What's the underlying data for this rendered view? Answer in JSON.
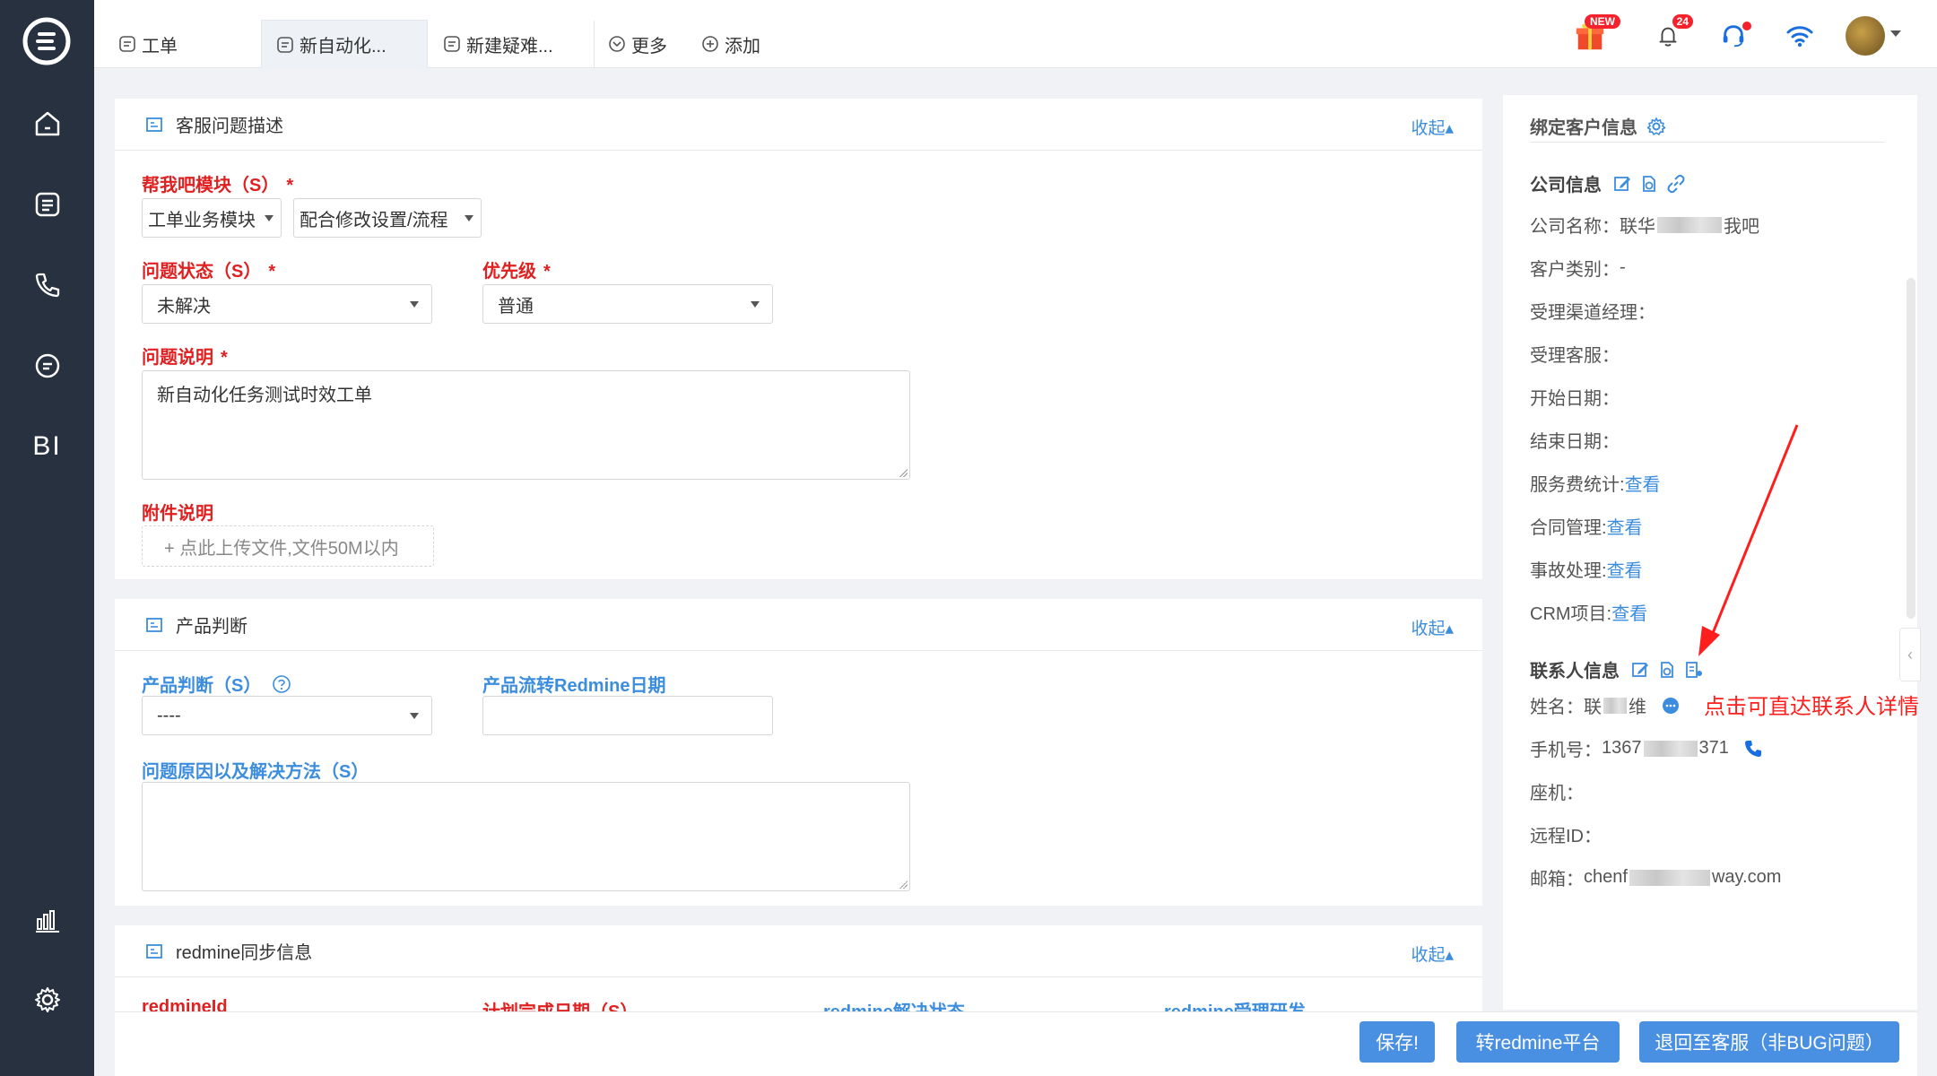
{
  "sidebar": {
    "logo_icon": "app-logo-icon",
    "items": [
      {
        "name": "home",
        "icon": "home-icon"
      },
      {
        "name": "ticket",
        "icon": "list-icon"
      },
      {
        "name": "phone",
        "icon": "phone-icon"
      },
      {
        "name": "chat",
        "icon": "chat-icon"
      },
      {
        "name": "bi",
        "label": "BI"
      },
      {
        "name": "stats",
        "icon": "bar-chart-icon"
      },
      {
        "name": "settings",
        "icon": "gear-icon"
      }
    ]
  },
  "tabs": [
    {
      "label": "工单",
      "active": false
    },
    {
      "label": "新自动化...",
      "active": true
    },
    {
      "label": "新建疑难...",
      "active": false
    }
  ],
  "top_links": {
    "more": "更多",
    "add": "添加"
  },
  "top_icons": {
    "gift_badge": "NEW",
    "bell_badge": "24"
  },
  "section_issue": {
    "title": "客服问题描述",
    "collapse": "收起",
    "module_label": "帮我吧模块（S）",
    "module_select_1": "工单业务模块",
    "module_select_2": "配合修改设置/流程",
    "status_label": "问题状态（S）",
    "status_value": "未解决",
    "priority_label": "优先级",
    "priority_value": "普通",
    "desc_label": "问题说明",
    "desc_value": "新自动化任务测试时效工单",
    "attach_label": "附件说明",
    "attach_hint": "+ 点此上传文件,文件50M以内"
  },
  "section_product": {
    "title": "产品判断",
    "collapse": "收起",
    "judge_label": "产品判断（S）",
    "judge_value": "----",
    "redmine_date_label": "产品流转Redmine日期",
    "cause_label": "问题原因以及解决方法（S）"
  },
  "section_redmine": {
    "title": "redmine同步信息",
    "collapse": "收起",
    "col1": "redmineId",
    "col2": "计划完成日期（S）",
    "col3": "redmine解决状态",
    "col4": "redmine受理研发"
  },
  "customer": {
    "title": "绑定客户信息",
    "company_section": "公司信息",
    "company_name_label": "公司名称：",
    "company_name_a": "联华",
    "company_name_b": "我吧",
    "category_label": "客户类别：",
    "category_value": "-",
    "channel_manager_label": "受理渠道经理：",
    "service_label": "受理客服：",
    "start_date_label": "开始日期：",
    "end_date_label": "结束日期：",
    "fee_label": "服务费统计:",
    "fee_link": "查看",
    "contract_label": "合同管理:",
    "contract_link": "查看",
    "incident_label": "事故处理:",
    "incident_link": "查看",
    "crm_label": "CRM项目:",
    "crm_link": "查看",
    "contact_section": "联系人信息",
    "contact_name_label": "姓名：",
    "contact_name_a": "联",
    "contact_name_b": "维",
    "mobile_label": "手机号：",
    "mobile_a": "1367",
    "mobile_b": "371",
    "landline_label": "座机：",
    "remote_label": "远程ID：",
    "email_label": "邮箱：",
    "email_a": "chenf",
    "email_b": "way.com"
  },
  "annotation": "点击可直达联系人详情",
  "actions": {
    "save": "保存!",
    "to_redmine": "转redmine平台",
    "return_service": "退回至客服（非BUG问题）"
  },
  "colors": {
    "sidebar": "#27313f",
    "accent": "#4a90e2",
    "link": "#3c8dde",
    "required": "#e02020",
    "annotation": "#ff1e1e"
  }
}
